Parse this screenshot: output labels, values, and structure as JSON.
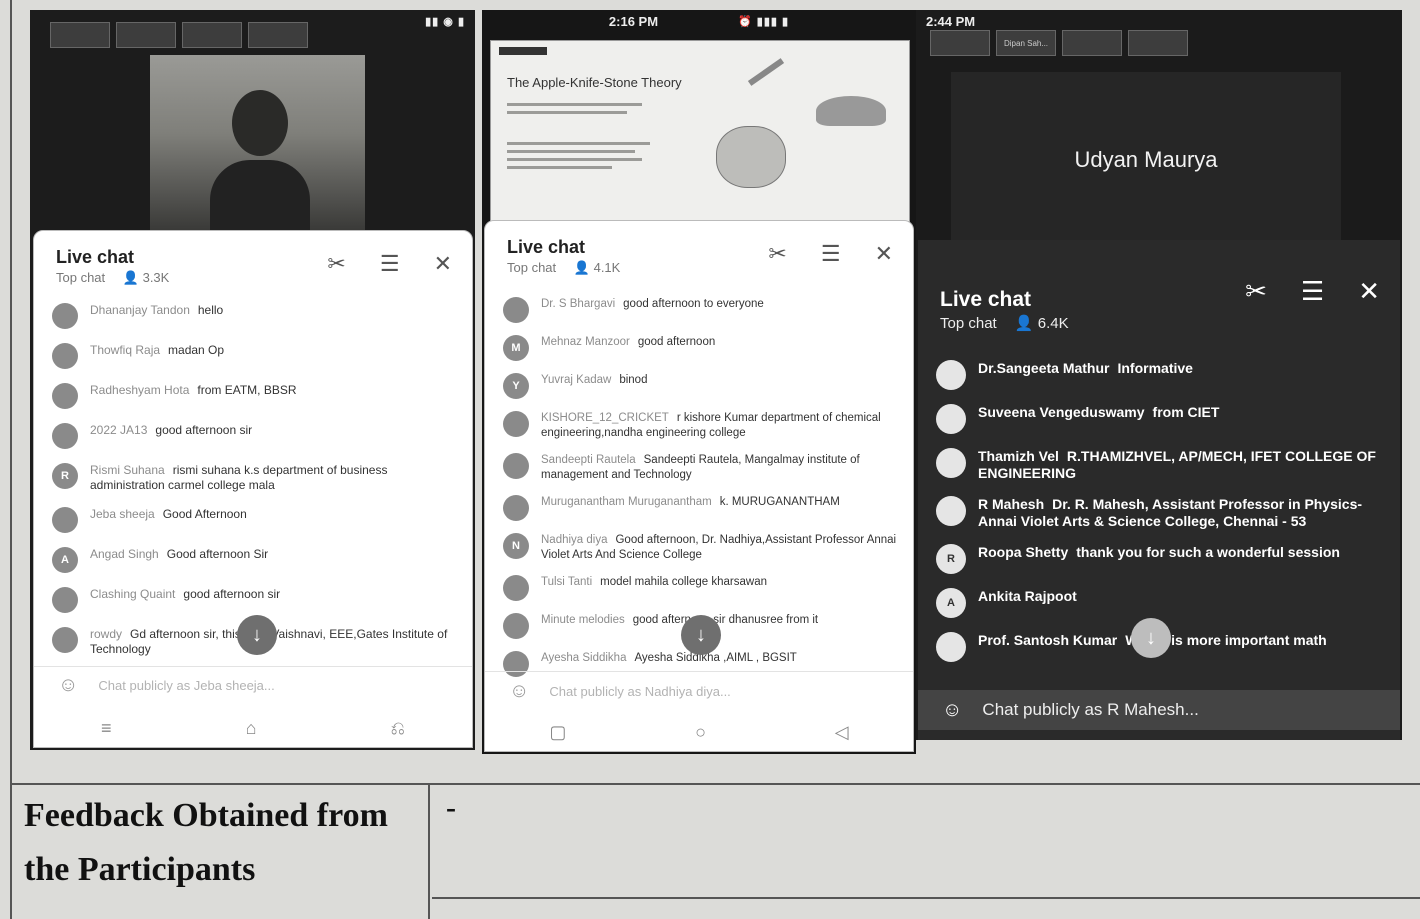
{
  "phone1": {
    "status_time": "",
    "thumbs": [
      "",
      "",
      "",
      ""
    ],
    "chat": {
      "title": "Live chat",
      "subtitle": "Top chat",
      "count": "3.3K",
      "messages": [
        {
          "avatar": "",
          "author": "Dhananjay Tandon",
          "text": "hello"
        },
        {
          "avatar": "",
          "author": "Thowfiq Raja",
          "text": "madan Op"
        },
        {
          "avatar": "",
          "author": "Radheshyam Hota",
          "text": "from EATM, BBSR"
        },
        {
          "avatar": "",
          "author": "2022 JA13",
          "text": "good afternoon sir"
        },
        {
          "avatar": "R",
          "author": "Rismi Suhana",
          "text": "rismi suhana k.s department of business administration carmel college mala"
        },
        {
          "avatar": "",
          "author": "Jeba sheeja",
          "text": "Good Afternoon"
        },
        {
          "avatar": "A",
          "author": "Angad Singh",
          "text": "Good afternoon Sir"
        },
        {
          "avatar": "",
          "author": "Clashing Quaint",
          "text": "good afternoon sir"
        },
        {
          "avatar": "",
          "author": "rowdy",
          "text": "Gd afternoon sir, this is C. Vaishnavi, EEE,Gates Institute of Technology"
        }
      ],
      "placeholder": "Chat publicly as Jeba sheeja..."
    }
  },
  "phone2": {
    "status_time": "2:16 PM",
    "slide_title": "The Apple-Knife-Stone Theory",
    "chat": {
      "title": "Live chat",
      "subtitle": "Top chat",
      "count": "4.1K",
      "messages": [
        {
          "avatar": "",
          "author": "Dr. S Bhargavi",
          "text": "good afternoon to everyone"
        },
        {
          "avatar": "M",
          "author": "Mehnaz Manzoor",
          "text": "good afternoon"
        },
        {
          "avatar": "Y",
          "author": "Yuvraj Kadaw",
          "text": "binod"
        },
        {
          "avatar": "",
          "author": "KISHORE_12_CRICKET",
          "text": "r kishore Kumar department of chemical engineering,nandha engineering college"
        },
        {
          "avatar": "",
          "author": "Sandeepti Rautela",
          "text": "Sandeepti Rautela, Mangalmay institute of management and Technology"
        },
        {
          "avatar": "",
          "author": "Muruganantham Muruganantham",
          "text": "k. MURUGANANTHAM"
        },
        {
          "avatar": "N",
          "author": "Nadhiya diya",
          "text": "Good afternoon, Dr. Nadhiya,Assistant Professor Annai Violet Arts And Science College"
        },
        {
          "avatar": "",
          "author": "Tulsi Tanti",
          "text": "model mahila college kharsawan"
        },
        {
          "avatar": "",
          "author": "Minute melodies",
          "text": "good afternoon sir dhanusree from it"
        },
        {
          "avatar": "",
          "author": "Ayesha Siddikha",
          "text": "Ayesha Siddikha ,AIML , BGSIT"
        }
      ],
      "placeholder": "Chat publicly as Nadhiya diya..."
    }
  },
  "phone3": {
    "status_time": "2:44 PM",
    "thumbs": [
      "Dipan Sah..."
    ],
    "presenter": "Udyan Maurya",
    "chat": {
      "title": "Live chat",
      "subtitle": "Top chat",
      "count": "6.4K",
      "messages": [
        {
          "avatar": "",
          "author": "Dr.Sangeeta Mathur",
          "text": "Informative"
        },
        {
          "avatar": "",
          "author": "Suveena Vengeduswamy",
          "text": "from CIET"
        },
        {
          "avatar": "",
          "author": "Thamizh Vel",
          "text": "R.THAMIZHVEL, AP/MECH, IFET COLLEGE OF ENGINEERING"
        },
        {
          "avatar": "",
          "author": "R Mahesh",
          "text": "Dr. R. Mahesh, Assistant Professor in Physics- Annai Violet Arts & Science College, Chennai - 53"
        },
        {
          "avatar": "R",
          "author": "Roopa Shetty",
          "text": "thank you for such a wonderful session"
        },
        {
          "avatar": "A",
          "author": "Ankita Rajpoot",
          "text": ""
        },
        {
          "avatar": "",
          "author": "Prof. Santosh Kumar",
          "text": "Which is more important math"
        }
      ],
      "placeholder": "Chat publicly as R Mahesh..."
    }
  },
  "table": {
    "label": "Feedback Obtained from the Participants",
    "value": "-"
  },
  "colors": {
    "frame": "#555555",
    "paper": "#dcdcd9",
    "chat_dark": "#2a2a2a"
  }
}
